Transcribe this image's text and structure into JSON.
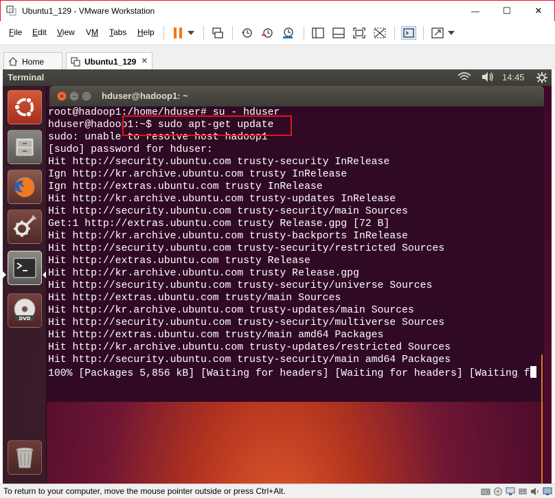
{
  "window": {
    "title": "Ubuntu1_129 - VMware Workstation",
    "min_glyph": "—",
    "max_glyph": "☐",
    "close_glyph": "✕"
  },
  "menu": [
    {
      "label": "File",
      "key": "F",
      "rest": "ile"
    },
    {
      "label": "Edit",
      "key": "E",
      "rest": "dit"
    },
    {
      "label": "View",
      "key": "V",
      "rest": "iew"
    },
    {
      "label": "VM",
      "key": "M",
      "pre": "V"
    },
    {
      "label": "Tabs",
      "key": "T",
      "rest": "abs"
    },
    {
      "label": "Help",
      "key": "H",
      "rest": "elp"
    }
  ],
  "toolbar_icons": [
    "pause-icon",
    "dropdown-arrow-icon",
    "send-ctrl-alt-del-icon",
    "snapshot-icon",
    "revert-snapshot-icon",
    "snapshot-manager-icon",
    "sidebar-icon",
    "console-view-icon",
    "fullscreen-icon",
    "unity-icon",
    "terminal-view-icon",
    "stretch-icon",
    "stretch-dropdown-icon"
  ],
  "tabs": [
    {
      "label": "Home",
      "icon": "home-icon"
    },
    {
      "label": "Ubuntu1_129",
      "icon": "vm-icon",
      "active": true
    }
  ],
  "tab_close_glyph": "✕",
  "guest": {
    "topbar_title": "Terminal",
    "time": "14:45",
    "tray_icons": [
      "wifi-icon",
      "volume-icon",
      "settings-icon"
    ],
    "launcher": [
      "ubuntu-dash-icon",
      "files-icon",
      "firefox-icon",
      "system-settings-icon",
      "terminal-icon",
      "dvd-icon",
      "trash-icon"
    ]
  },
  "terminal": {
    "title": "hduser@hadoop1: ~",
    "close_glyph": "×",
    "min_glyph": "–",
    "max_glyph": "□",
    "lines": [
      "root@hadoop1:/home/hduser# su - hduser",
      "hduser@hadoop1:~$ sudo apt-get update",
      "sudo: unable to resolve host hadoop1",
      "[sudo] password for hduser:",
      "Hit http://security.ubuntu.com trusty-security InRelease",
      "Ign http://kr.archive.ubuntu.com trusty InRelease",
      "Ign http://extras.ubuntu.com trusty InRelease",
      "Hit http://kr.archive.ubuntu.com trusty-updates InRelease",
      "Hit http://security.ubuntu.com trusty-security/main Sources",
      "Get:1 http://extras.ubuntu.com trusty Release.gpg [72 B]",
      "Hit http://kr.archive.ubuntu.com trusty-backports InRelease",
      "Hit http://security.ubuntu.com trusty-security/restricted Sources",
      "Hit http://extras.ubuntu.com trusty Release",
      "Hit http://kr.archive.ubuntu.com trusty Release.gpg",
      "Hit http://security.ubuntu.com trusty-security/universe Sources",
      "Hit http://extras.ubuntu.com trusty/main Sources",
      "Hit http://kr.archive.ubuntu.com trusty-updates/main Sources",
      "Hit http://security.ubuntu.com trusty-security/multiverse Sources",
      "Hit http://extras.ubuntu.com trusty/main amd64 Packages",
      "Hit http://kr.archive.ubuntu.com trusty-updates/restricted Sources",
      "Hit http://security.ubuntu.com trusty-security/main amd64 Packages",
      "100% [Packages 5,856 kB] [Waiting for headers] [Waiting for headers] [Waiting f"
    ]
  },
  "statusbar": {
    "text": "To return to your computer, move the mouse pointer outside or press Ctrl+Alt.",
    "icons": [
      "hard-disk-icon",
      "cd-drive-icon",
      "network-icon",
      "usb-icon",
      "sound-icon",
      "display-icon"
    ]
  },
  "colors": {
    "terminal_bg": "#300a24",
    "highlight": "#e0141e",
    "close_button": "#e81123"
  }
}
